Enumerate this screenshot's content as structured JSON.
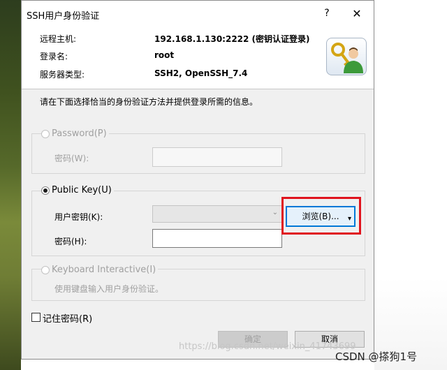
{
  "window": {
    "title": "SSH用户身份验证",
    "help": "?",
    "close": "✕"
  },
  "info": {
    "host_label": "远程主机:",
    "host_value": "192.168.1.130:2222 (密钥认证登录)",
    "user_label": "登录名:",
    "user_value": "root",
    "type_label": "服务器类型:",
    "type_value": "SSH2, OpenSSH_7.4"
  },
  "instruction": "请在下面选择恰当的身份验证方法并提供登录所需的信息。",
  "password_group": {
    "radio_label": "Password(P)",
    "field_label": "密码(W):",
    "value": "",
    "selected": false,
    "enabled": false
  },
  "pubkey_group": {
    "radio_label": "Public Key(U)",
    "selected": true,
    "user_key_label": "用户密钥(K):",
    "user_key_value": "",
    "passphrase_label": "密码(H):",
    "passphrase_value": "",
    "browse_label": "浏览(B)..."
  },
  "keyboard_group": {
    "radio_label": "Keyboard Interactive(I)",
    "description": "使用键盘输入用户身份验证。",
    "selected": false,
    "enabled": false
  },
  "remember": {
    "label": "记住密码(R)",
    "checked": false
  },
  "buttons": {
    "ok": "确定",
    "cancel": "取消"
  },
  "watermark": "https://blog.csdn.net/weixin_41743699",
  "csdn_badge": "CSDN @搽狗1号",
  "colors": {
    "highlight": "#e0141e",
    "focus": "#0078d7"
  }
}
